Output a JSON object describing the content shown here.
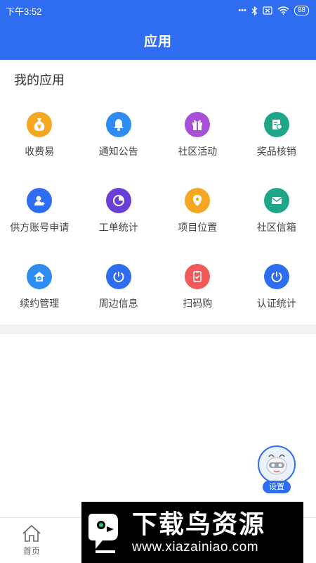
{
  "status": {
    "time": "下午3:52",
    "battery": "88"
  },
  "header": {
    "title": "应用"
  },
  "section": {
    "title": "我的应用"
  },
  "apps": [
    {
      "label": "收费易",
      "icon": "money-bag-icon",
      "color": "#f5a623"
    },
    {
      "label": "通知公告",
      "icon": "bell-icon",
      "color": "#2f8cf0"
    },
    {
      "label": "社区活动",
      "icon": "gift-icon",
      "color": "#a84fd9"
    },
    {
      "label": "奖品核销",
      "icon": "badge-icon",
      "color": "#1fa588"
    },
    {
      "label": "供方账号申请",
      "icon": "user-add-icon",
      "color": "#2f6df0"
    },
    {
      "label": "工单统计",
      "icon": "pie-chart-icon",
      "color": "#6a3fd9"
    },
    {
      "label": "项目位置",
      "icon": "location-pin-icon",
      "color": "#f5a623"
    },
    {
      "label": "社区信箱",
      "icon": "mail-icon",
      "color": "#1fa588"
    },
    {
      "label": "续约管理",
      "icon": "home-check-icon",
      "color": "#2f8cf0"
    },
    {
      "label": "周边信息",
      "icon": "power-icon",
      "color": "#2f6df0"
    },
    {
      "label": "扫码购",
      "icon": "scan-cart-icon",
      "color": "#f05a5a"
    },
    {
      "label": "认证统计",
      "icon": "power-icon",
      "color": "#2f6df0"
    }
  ],
  "floating": {
    "label": "设置",
    "icon": "robot-avatar-icon"
  },
  "tabbar": {
    "home_label": "首页"
  },
  "watermark": {
    "cn_text": "下载鸟资源",
    "url": "www.xiazainiao.com"
  },
  "colors": {
    "primary": "#2f6df0",
    "divider": "#f2f2f2"
  }
}
